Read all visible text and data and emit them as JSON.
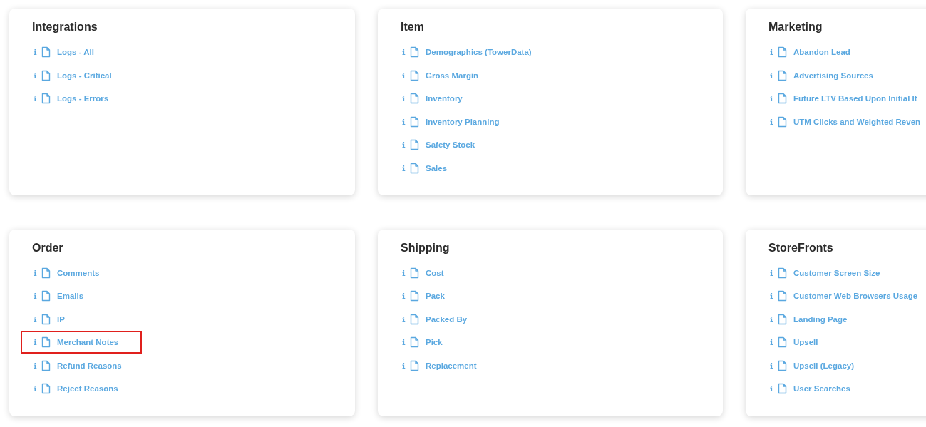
{
  "categories": [
    {
      "title": "Integrations",
      "reports": [
        {
          "label": "Logs - All",
          "highlighted": false
        },
        {
          "label": "Logs - Critical",
          "highlighted": false
        },
        {
          "label": "Logs - Errors",
          "highlighted": false
        }
      ]
    },
    {
      "title": "Item",
      "reports": [
        {
          "label": "Demographics (TowerData)",
          "highlighted": false
        },
        {
          "label": "Gross Margin",
          "highlighted": false
        },
        {
          "label": "Inventory",
          "highlighted": false
        },
        {
          "label": "Inventory Planning",
          "highlighted": false
        },
        {
          "label": "Safety Stock",
          "highlighted": false
        },
        {
          "label": "Sales",
          "highlighted": false
        }
      ]
    },
    {
      "title": "Marketing",
      "reports": [
        {
          "label": "Abandon Lead",
          "highlighted": false
        },
        {
          "label": "Advertising Sources",
          "highlighted": false
        },
        {
          "label": "Future LTV Based Upon Initial It",
          "highlighted": false
        },
        {
          "label": "UTM Clicks and Weighted Reven",
          "highlighted": false
        }
      ]
    },
    {
      "title": "Order",
      "reports": [
        {
          "label": "Comments",
          "highlighted": false
        },
        {
          "label": "Emails",
          "highlighted": false
        },
        {
          "label": "IP",
          "highlighted": false
        },
        {
          "label": "Merchant Notes",
          "highlighted": true
        },
        {
          "label": "Refund Reasons",
          "highlighted": false
        },
        {
          "label": "Reject Reasons",
          "highlighted": false
        }
      ]
    },
    {
      "title": "Shipping",
      "reports": [
        {
          "label": "Cost",
          "highlighted": false
        },
        {
          "label": "Pack",
          "highlighted": false
        },
        {
          "label": "Packed By",
          "highlighted": false
        },
        {
          "label": "Pick",
          "highlighted": false
        },
        {
          "label": "Replacement",
          "highlighted": false
        }
      ]
    },
    {
      "title": "StoreFronts",
      "reports": [
        {
          "label": "Customer Screen Size",
          "highlighted": false
        },
        {
          "label": "Customer Web Browsers Usage",
          "highlighted": false
        },
        {
          "label": "Landing Page",
          "highlighted": false
        },
        {
          "label": "Upsell",
          "highlighted": false
        },
        {
          "label": "Upsell (Legacy)",
          "highlighted": false
        },
        {
          "label": "User Searches",
          "highlighted": false
        }
      ]
    }
  ]
}
